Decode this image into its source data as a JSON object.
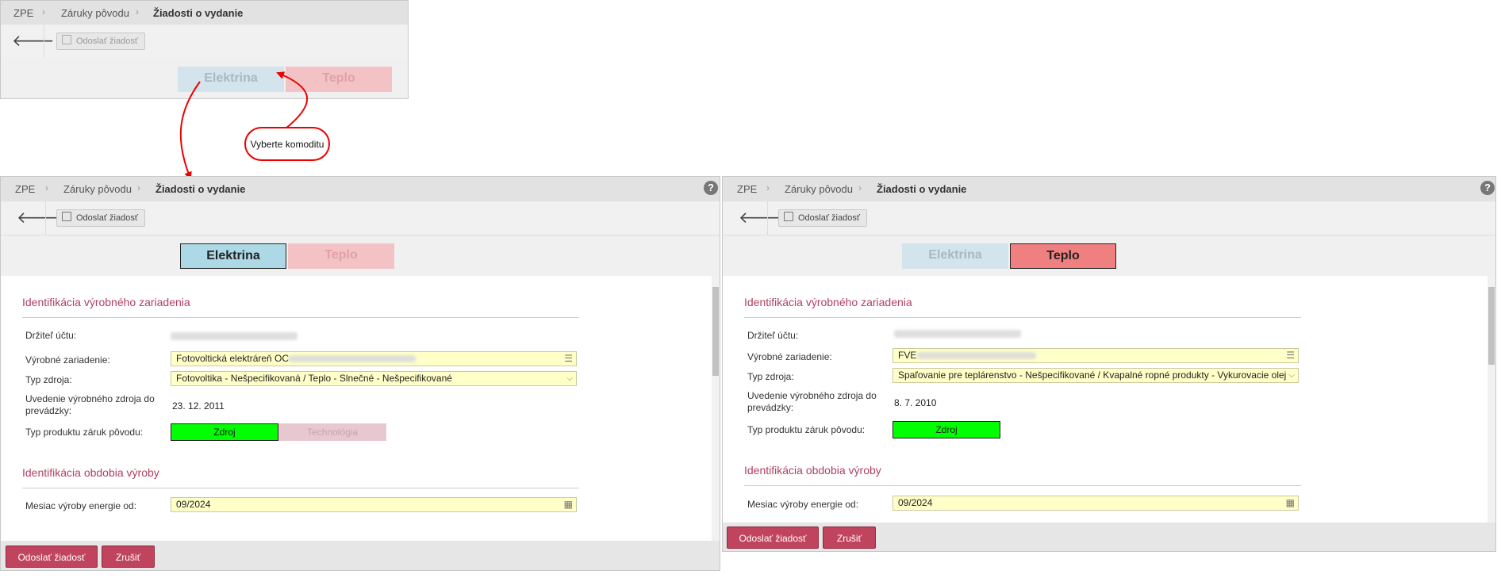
{
  "breadcrumb": [
    "ZPE",
    "Záruky pôvodu",
    "Žiadosti o vydanie"
  ],
  "toolbar": {
    "submit_label": "Odoslať žiadosť"
  },
  "commodity": {
    "electricity": "Elektrina",
    "heat": "Teplo"
  },
  "callout": "Vyberte komoditu",
  "sections": {
    "device": "Identifikácia výrobného zariadenia",
    "period": "Identifikácia obdobia výroby"
  },
  "labels": {
    "holder": "Držiteľ účtu:",
    "device": "Výrobné zariadenie:",
    "source_type": "Typ zdroja:",
    "commissioning": "Uvedenie výrobného zdroja do prevádzky:",
    "product_type": "Typ produktu záruk pôvodu:",
    "month_from": "Mesiac výroby energie od:"
  },
  "products": {
    "source": "Zdroj",
    "technology": "Technológia"
  },
  "left": {
    "device_value": "Fotovoltická elektráreň OC",
    "source_type_value": "Fotovoltika - Nešpecifikovaná / Teplo - Slnečné - Nešpecifikované",
    "commissioning_value": "23. 12. 2011",
    "month_from_value": "09/2024"
  },
  "right": {
    "device_value": "FVE",
    "source_type_value": "Spaľovanie pre teplárenstvo - Nešpecifikované / Kvapalné ropné produkty - Vykurovacie olej",
    "commissioning_value": "8. 7. 2010",
    "month_from_value": "09/2024"
  },
  "footer": {
    "submit": "Odoslať žiadosť",
    "cancel": "Zrušiť"
  },
  "colors": {
    "accent": "#c0445e",
    "electricity": "#add8e6",
    "heat": "#f08080",
    "source_product": "#00ff00",
    "input_bg": "#ffffc8"
  },
  "icons": {
    "back": "arrow-left-icon",
    "save": "floppy-icon",
    "help": "question-icon",
    "list": "list-icon",
    "calendar": "calendar-icon",
    "dropdown": "chevron-down-icon"
  }
}
